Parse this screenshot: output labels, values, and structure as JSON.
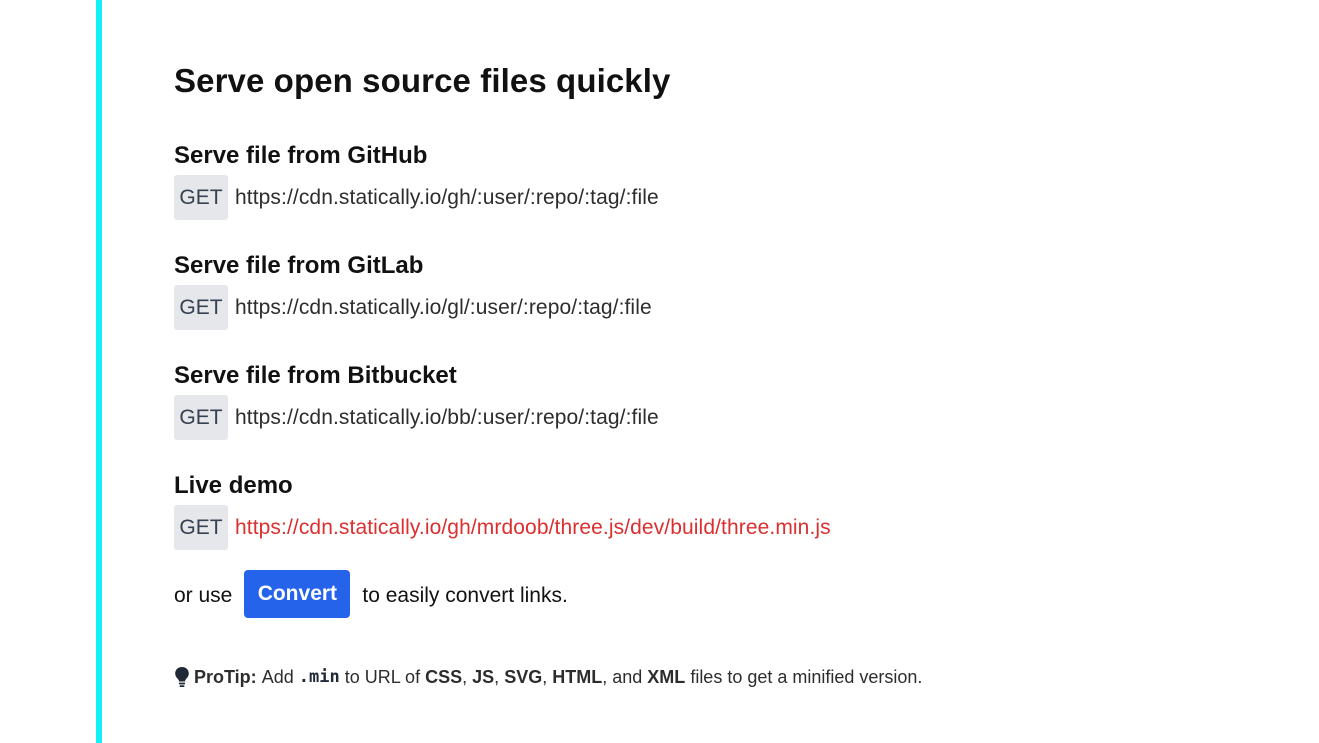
{
  "page": {
    "title": "Serve open source files quickly",
    "accent_color": "#13f1f8"
  },
  "sections": [
    {
      "title": "Serve file from GitHub",
      "method": "GET",
      "url": "https://cdn.statically.io/gh/:user/:repo/:tag/:file"
    },
    {
      "title": "Serve file from GitLab",
      "method": "GET",
      "url": "https://cdn.statically.io/gl/:user/:repo/:tag/:file"
    },
    {
      "title": "Serve file from Bitbucket",
      "method": "GET",
      "url": "https://cdn.statically.io/bb/:user/:repo/:tag/:file"
    },
    {
      "title": "Live demo",
      "method": "GET",
      "url": "https://cdn.statically.io/gh/mrdoob/three.js/dev/build/three.min.js",
      "link_color": "#dc2f2f"
    }
  ],
  "convert": {
    "prefix": "or use",
    "button_label": "Convert",
    "suffix": "to easily convert links.",
    "button_color": "#2563eb"
  },
  "protip": {
    "icon": "lightbulb-icon",
    "label": "ProTip:",
    "text1": "Add",
    "code": ".min",
    "text2": "to URL of",
    "css": "CSS",
    "sep1": ",",
    "js": "JS",
    "sep2": ",",
    "svg": "SVG",
    "sep3": ",",
    "html": "HTML",
    "text3": ", and",
    "xml": "XML",
    "text4": "files to get a minified version."
  }
}
